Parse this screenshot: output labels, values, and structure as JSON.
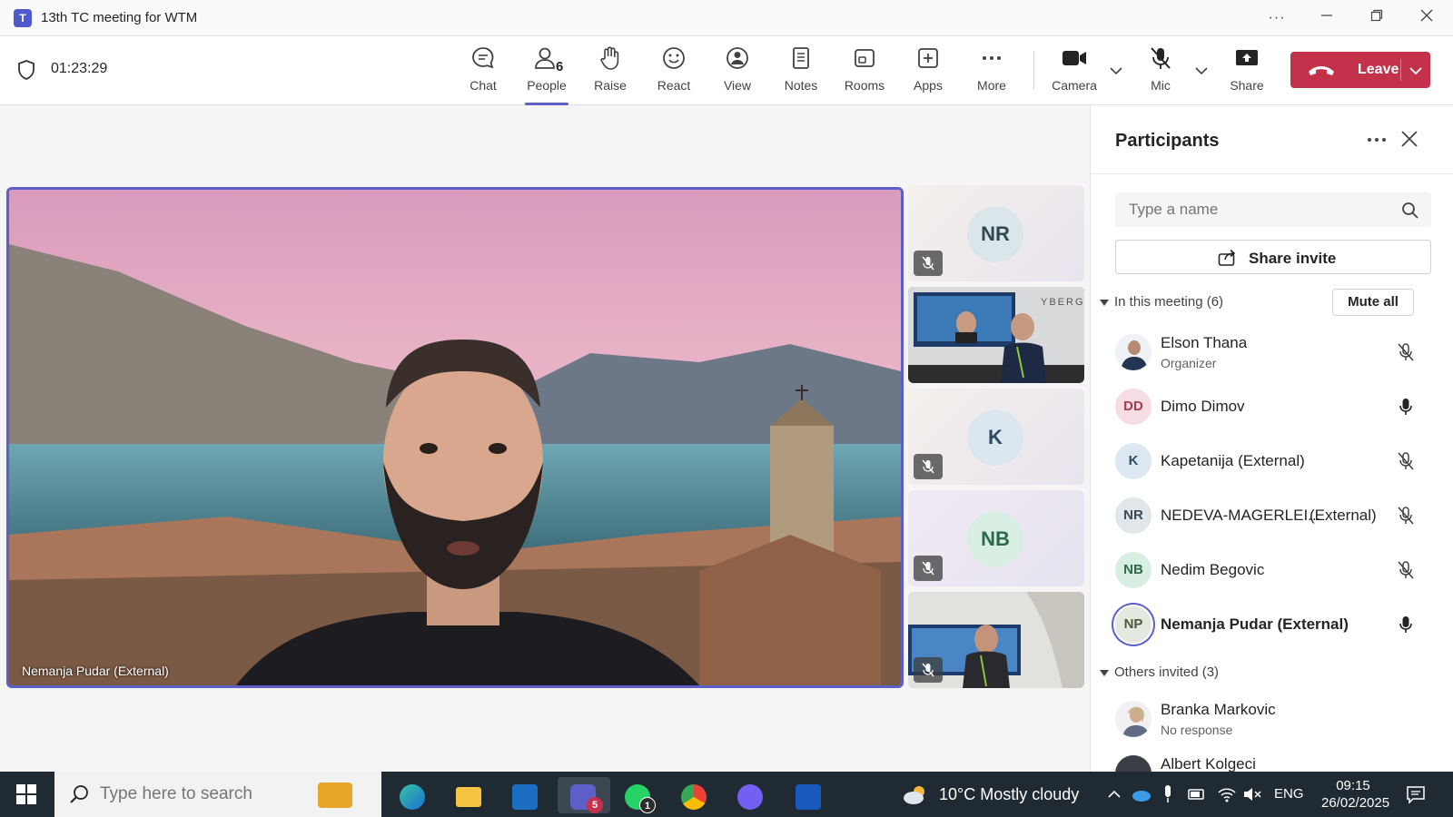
{
  "window": {
    "title": "13th TC meeting for WTM",
    "more_label": "···"
  },
  "toolbar": {
    "timer": "01:23:29",
    "people_count": "6",
    "buttons": {
      "chat": "Chat",
      "people": "People",
      "raise": "Raise",
      "react": "React",
      "view": "View",
      "notes": "Notes",
      "rooms": "Rooms",
      "apps": "Apps",
      "more": "More",
      "camera": "Camera",
      "mic": "Mic",
      "share": "Share"
    },
    "leave_label": "Leave",
    "leave_color": "#c4314b",
    "accent": "#5b5fc7"
  },
  "stage": {
    "main_speaker_name": "Nemanja Pudar (External)",
    "tiles": [
      {
        "initials": "NR",
        "type": "avatar",
        "muted": true
      },
      {
        "type": "video",
        "muted": false,
        "overlay_text": "YBERG"
      },
      {
        "initials": "K",
        "type": "avatar",
        "muted": true
      },
      {
        "initials": "NB",
        "type": "avatar",
        "muted": true
      },
      {
        "type": "video",
        "muted": true
      }
    ]
  },
  "participants": {
    "title": "Participants",
    "search_placeholder": "Type a name",
    "share_invite_label": "Share invite",
    "in_meeting_label": "In this meeting (6)",
    "mute_all_label": "Mute all",
    "in_meeting": [
      {
        "name": "Elson Thana",
        "role": "Organizer",
        "initials": "",
        "mic": "muted"
      },
      {
        "name": "Dimo Dimov",
        "role": "",
        "initials": "DD",
        "mic": "on"
      },
      {
        "name": "Kapetanija (External)",
        "role": "",
        "initials": "K",
        "mic": "muted"
      },
      {
        "name": "NEDEVA-MAGERLEI...",
        "name_suffix": "(External)",
        "role": "",
        "initials": "NR",
        "mic": "muted"
      },
      {
        "name": "Nedim Begovic",
        "role": "",
        "initials": "NB",
        "mic": "muted"
      },
      {
        "name": "Nemanja Pudar (External)",
        "role": "",
        "initials": "NP",
        "mic": "on"
      }
    ],
    "others_label": "Others invited (3)",
    "others": [
      {
        "name": "Branka Markovic",
        "role": "No response"
      },
      {
        "name": "Albert Kolgeci",
        "role": ""
      }
    ]
  },
  "taskbar": {
    "search_placeholder": "Type here to search",
    "teams_badge": "5",
    "whatsapp_badge": "1",
    "weather": "10°C  Mostly cloudy",
    "language": "ENG",
    "time": "09:15",
    "date": "26/02/2025"
  }
}
